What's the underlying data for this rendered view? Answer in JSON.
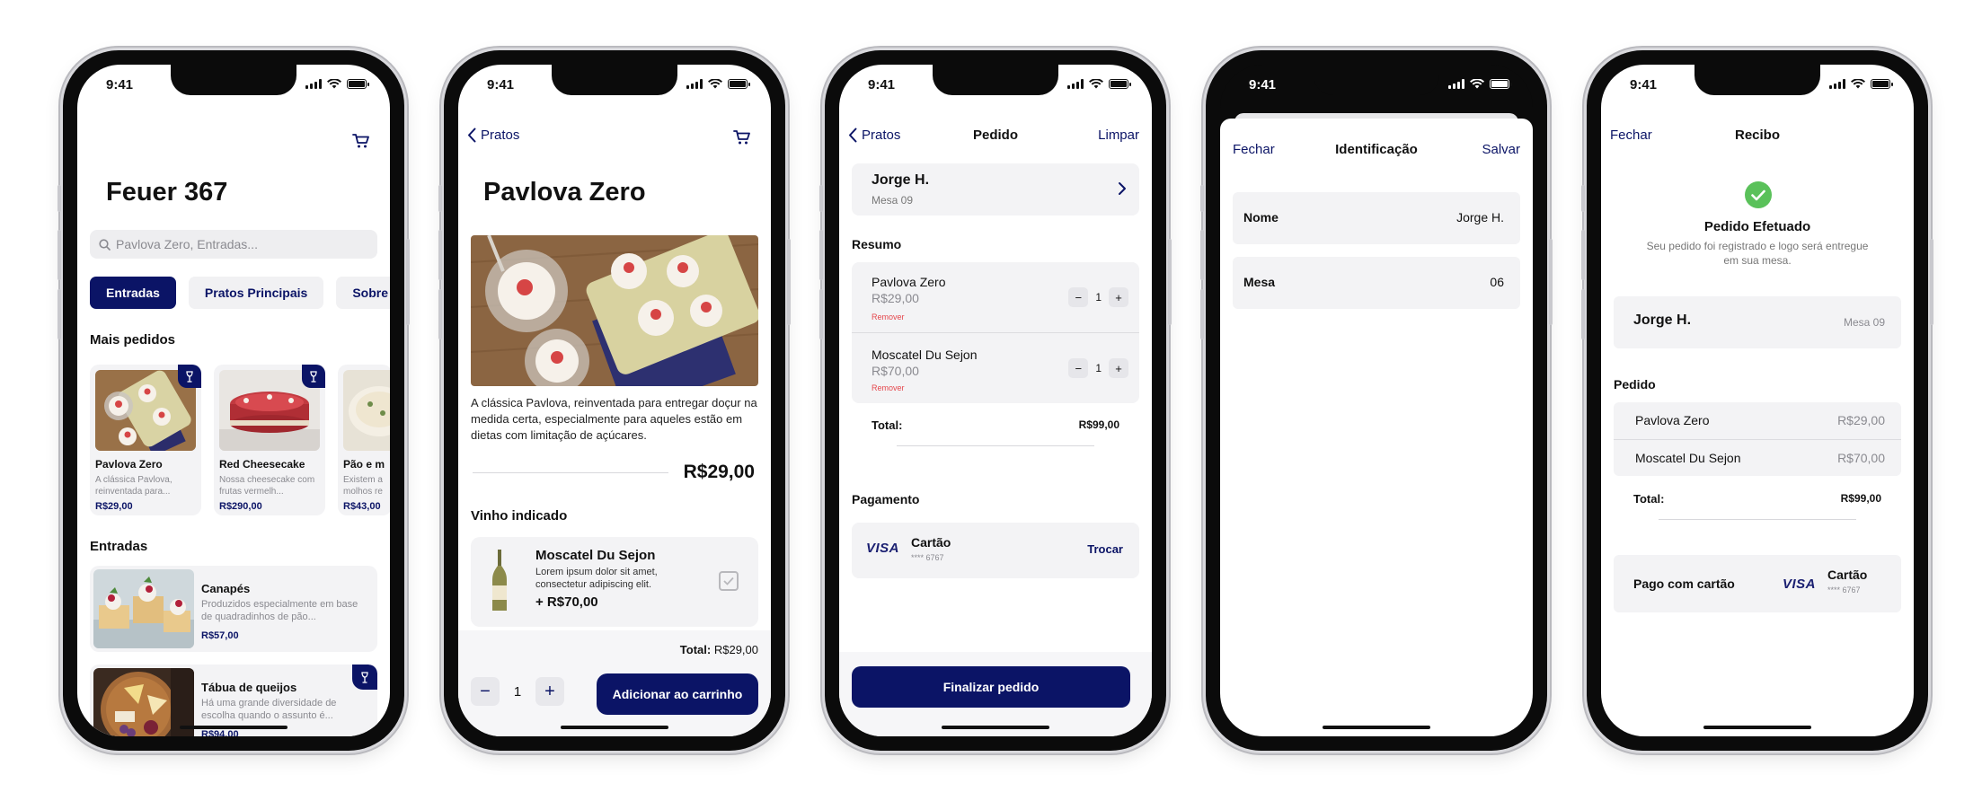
{
  "status_time": "9:41",
  "colors": {
    "accent": "#0b1466",
    "danger": "#e5484d",
    "success": "#5ac15a",
    "card": "#f3f3f5"
  },
  "screen1": {
    "title": "Feuer 367",
    "search_placeholder": "Pavlova Zero, Entradas...",
    "chips": [
      "Entradas",
      "Pratos Principais",
      "Sobre"
    ],
    "popular_heading": "Mais pedidos",
    "popular": [
      {
        "name": "Pavlova Zero",
        "desc": "A clássica Pavlova, reinventada para...",
        "price": "R$29,00"
      },
      {
        "name": "Red Cheesecake",
        "desc": "Nossa cheesecake com frutas vermelh...",
        "price": "R$290,00"
      },
      {
        "name": "Pão e m",
        "desc": "Existem a molhos re",
        "price": "R$43,00"
      }
    ],
    "starters_heading": "Entradas",
    "starters": [
      {
        "name": "Canapés",
        "desc": "Produzidos especialmente em base de quadradinhos de pão...",
        "price": "R$57,00"
      },
      {
        "name": "Tábua de queijos",
        "desc": "Há uma grande diversidade de escolha quando o assunto é...",
        "price": "R$94,00"
      }
    ]
  },
  "screen2": {
    "back": "Pratos",
    "title": "Pavlova Zero",
    "description": "A clássica Pavlova, reinventada para entregar doçur na medida certa, especialmente para aqueles estão em dietas com limitação de açúcares.",
    "price": "R$29,00",
    "wine_heading": "Vinho indicado",
    "wine": {
      "name": "Moscatel Du Sejon",
      "desc": "Lorem ipsum dolor sit amet, consectetur adipiscing elit.",
      "price": "+ R$70,00"
    },
    "total_label": "Total:",
    "total_value": "R$29,00",
    "quantity": "1",
    "add_button": "Adicionar ao carrinho"
  },
  "screen3": {
    "back": "Pratos",
    "title": "Pedido",
    "clear": "Limpar",
    "customer": {
      "name": "Jorge H.",
      "table": "Mesa 09"
    },
    "summary_heading": "Resumo",
    "items": [
      {
        "name": "Pavlova Zero",
        "price": "R$29,00",
        "remove": "Remover",
        "qty": "1"
      },
      {
        "name": "Moscatel Du Sejon",
        "price": "R$70,00",
        "remove": "Remover",
        "qty": "1"
      }
    ],
    "total_label": "Total:",
    "total_value": "R$99,00",
    "payment_heading": "Pagamento",
    "card_brand": "VISA",
    "card_name": "Cartão",
    "card_number": "**** 6767",
    "change": "Trocar",
    "finish_button": "Finalizar pedido"
  },
  "screen4": {
    "close": "Fechar",
    "title": "Identificação",
    "save": "Salvar",
    "fields": [
      {
        "label": "Nome",
        "value": "Jorge H."
      },
      {
        "label": "Mesa",
        "value": "06"
      }
    ]
  },
  "screen5": {
    "close": "Fechar",
    "title": "Recibo",
    "success_title": "Pedido Efetuado",
    "success_sub": "Seu pedido foi registrado e logo será entregue em sua mesa.",
    "customer": {
      "name": "Jorge H.",
      "table": "Mesa 09"
    },
    "order_heading": "Pedido",
    "items": [
      {
        "name": "Pavlova Zero",
        "price": "R$29,00"
      },
      {
        "name": "Moscatel Du Sejon",
        "price": "R$70,00"
      }
    ],
    "total_label": "Total:",
    "total_value": "R$99,00",
    "paid_label": "Pago com cartão",
    "card_brand": "VISA",
    "card_name": "Cartão",
    "card_number": "**** 6767"
  }
}
